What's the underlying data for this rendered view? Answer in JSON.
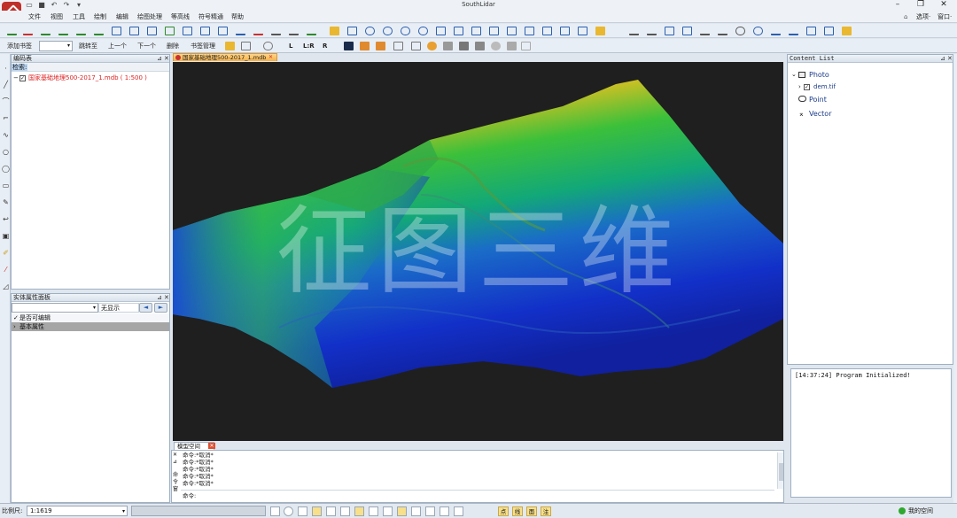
{
  "app": {
    "title": "SouthLidar"
  },
  "menu": [
    "文件",
    "视图",
    "工具",
    "绘制",
    "编辑",
    "绘图处理",
    "等高线",
    "符号精通",
    "帮助"
  ],
  "titlebar_right": {
    "options": "选项·",
    "window": "窗口·"
  },
  "toolbar2": {
    "add_bookmark": "添加书签",
    "goto": "跳转至",
    "prev": "上一个",
    "next": "下一个",
    "delete": "删除",
    "bookmark_mgr": "书签管理",
    "l": "L",
    "lr": "L:R",
    "r": "R"
  },
  "layer_panel": {
    "title": "编码表",
    "search_label": "检索:",
    "items": [
      {
        "label": "国家基础地理500-2017_1.mdb ( 1:500 )",
        "checked": true
      }
    ]
  },
  "prop_panel": {
    "title": "实体属性面板",
    "filter_value": "无显示",
    "rows": [
      {
        "label": "是否可编辑",
        "checked": true
      },
      {
        "label": "基本属性",
        "header": true
      }
    ]
  },
  "map": {
    "tab_label": "国家基础地理500-2017_1.mdb",
    "watermark": "征图三维",
    "colors": {
      "high": "#c8141a",
      "mid": "#2fbf3a",
      "low": "#1230c8",
      "background": "#1f1f1f"
    }
  },
  "command": {
    "tab_label": "模型空间",
    "lines": [
      "命令:*取消*",
      "命令:*取消*",
      "命令:*取消*",
      "命令:*取消*",
      "命令:*取消*"
    ],
    "prompt": "命令:"
  },
  "content_list": {
    "title": "Content List",
    "nodes": [
      {
        "label": "Photo",
        "icon": "photo-icon",
        "level": 0
      },
      {
        "label": "dem.tif",
        "icon": "checkbox-icon",
        "level": 1
      },
      {
        "label": "Point",
        "icon": "point-icon",
        "level": 0
      },
      {
        "label": "Vector",
        "icon": "vector-icon",
        "level": 0
      }
    ]
  },
  "log": {
    "text": "[14:37:24] Program Initialized!"
  },
  "status": {
    "scale_label": "比例尺:",
    "scale_value": "1:1619",
    "space": "我的空间"
  }
}
